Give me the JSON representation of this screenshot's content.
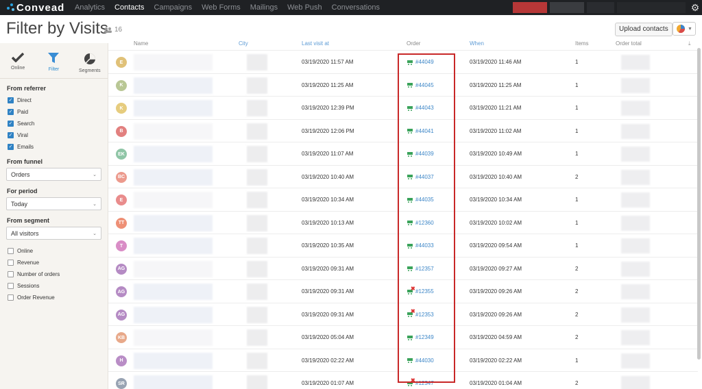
{
  "nav": {
    "logo": "Convead",
    "links": [
      "Analytics",
      "Contacts",
      "Campaigns",
      "Web Forms",
      "Mailings",
      "Web Push",
      "Conversations"
    ],
    "active": "Contacts"
  },
  "header": {
    "title": "Filter by Visits",
    "count": "16",
    "upload_label": "Upload contacts"
  },
  "sidebar": {
    "modes": [
      {
        "label": "Online",
        "icon": "check-icon"
      },
      {
        "label": "Filter",
        "icon": "filter-icon"
      },
      {
        "label": "Segments",
        "icon": "pie-chart-icon"
      }
    ],
    "active_mode": "Filter",
    "referrer_title": "From referrer",
    "referrers": [
      "Direct",
      "Paid",
      "Search",
      "Viral",
      "Emails"
    ],
    "funnel_title": "From funnel",
    "funnel_value": "Orders",
    "period_title": "For period",
    "period_value": "Today",
    "segment_title": "From segment",
    "segment_value": "All visitors",
    "extra_filters": [
      "Online",
      "Revenue",
      "Number of orders",
      "Sessions",
      "Order Revenue"
    ]
  },
  "table": {
    "columns": [
      "Name",
      "City",
      "Last visit at",
      "Order",
      "When",
      "Items",
      "Order total"
    ],
    "rows": [
      {
        "initials": "E",
        "color": "#e0c178",
        "last_visit": "03/19/2020 11:57 AM",
        "order": "#44049",
        "cancelled": false,
        "when": "03/19/2020 11:46 AM",
        "items": "1"
      },
      {
        "initials": "K",
        "color": "#b9c795",
        "last_visit": "03/19/2020 11:25 AM",
        "order": "#44045",
        "cancelled": false,
        "when": "03/19/2020 11:25 AM",
        "items": "1"
      },
      {
        "initials": "K",
        "color": "#e6cc7e",
        "last_visit": "03/19/2020 12:39 PM",
        "order": "#44043",
        "cancelled": false,
        "when": "03/19/2020 11:21 AM",
        "items": "1"
      },
      {
        "initials": "B",
        "color": "#e2807f",
        "last_visit": "03/19/2020 12:06 PM",
        "order": "#44041",
        "cancelled": false,
        "when": "03/19/2020 11:02 AM",
        "items": "1"
      },
      {
        "initials": "EK",
        "color": "#8fc5a6",
        "last_visit": "03/19/2020 11:07 AM",
        "order": "#44039",
        "cancelled": false,
        "when": "03/19/2020 10:49 AM",
        "items": "1"
      },
      {
        "initials": "BC",
        "color": "#ec9a8d",
        "last_visit": "03/19/2020 10:40 AM",
        "order": "#44037",
        "cancelled": false,
        "when": "03/19/2020 10:40 AM",
        "items": "2"
      },
      {
        "initials": "E",
        "color": "#e98c8c",
        "last_visit": "03/19/2020 10:34 AM",
        "order": "#44035",
        "cancelled": false,
        "when": "03/19/2020 10:34 AM",
        "items": "1"
      },
      {
        "initials": "TT",
        "color": "#ee9076",
        "last_visit": "03/19/2020 10:13 AM",
        "order": "#12360",
        "cancelled": false,
        "when": "03/19/2020 10:02 AM",
        "items": "1"
      },
      {
        "initials": "T",
        "color": "#d98dc6",
        "last_visit": "03/19/2020 10:35 AM",
        "order": "#44033",
        "cancelled": false,
        "when": "03/19/2020 09:54 AM",
        "items": "1"
      },
      {
        "initials": "AG",
        "color": "#b58bc4",
        "last_visit": "03/19/2020 09:31 AM",
        "order": "#12357",
        "cancelled": false,
        "when": "03/19/2020 09:27 AM",
        "items": "2"
      },
      {
        "initials": "AG",
        "color": "#b58bc4",
        "last_visit": "03/19/2020 09:31 AM",
        "order": "#12355",
        "cancelled": true,
        "when": "03/19/2020 09:26 AM",
        "items": "2"
      },
      {
        "initials": "AG",
        "color": "#b58bc4",
        "last_visit": "03/19/2020 09:31 AM",
        "order": "#12353",
        "cancelled": true,
        "when": "03/19/2020 09:26 AM",
        "items": "2"
      },
      {
        "initials": "KB",
        "color": "#e8a98a",
        "last_visit": "03/19/2020 05:04 AM",
        "order": "#12349",
        "cancelled": false,
        "when": "03/19/2020 04:59 AM",
        "items": "2"
      },
      {
        "initials": "H",
        "color": "#b98dc6",
        "last_visit": "03/19/2020 02:22 AM",
        "order": "#44030",
        "cancelled": false,
        "when": "03/19/2020 02:22 AM",
        "items": "1"
      },
      {
        "initials": "SR",
        "color": "#98a3b3",
        "last_visit": "03/19/2020 01:07 AM",
        "order": "#12347",
        "cancelled": true,
        "when": "03/19/2020 01:04 AM",
        "items": "2"
      }
    ]
  }
}
